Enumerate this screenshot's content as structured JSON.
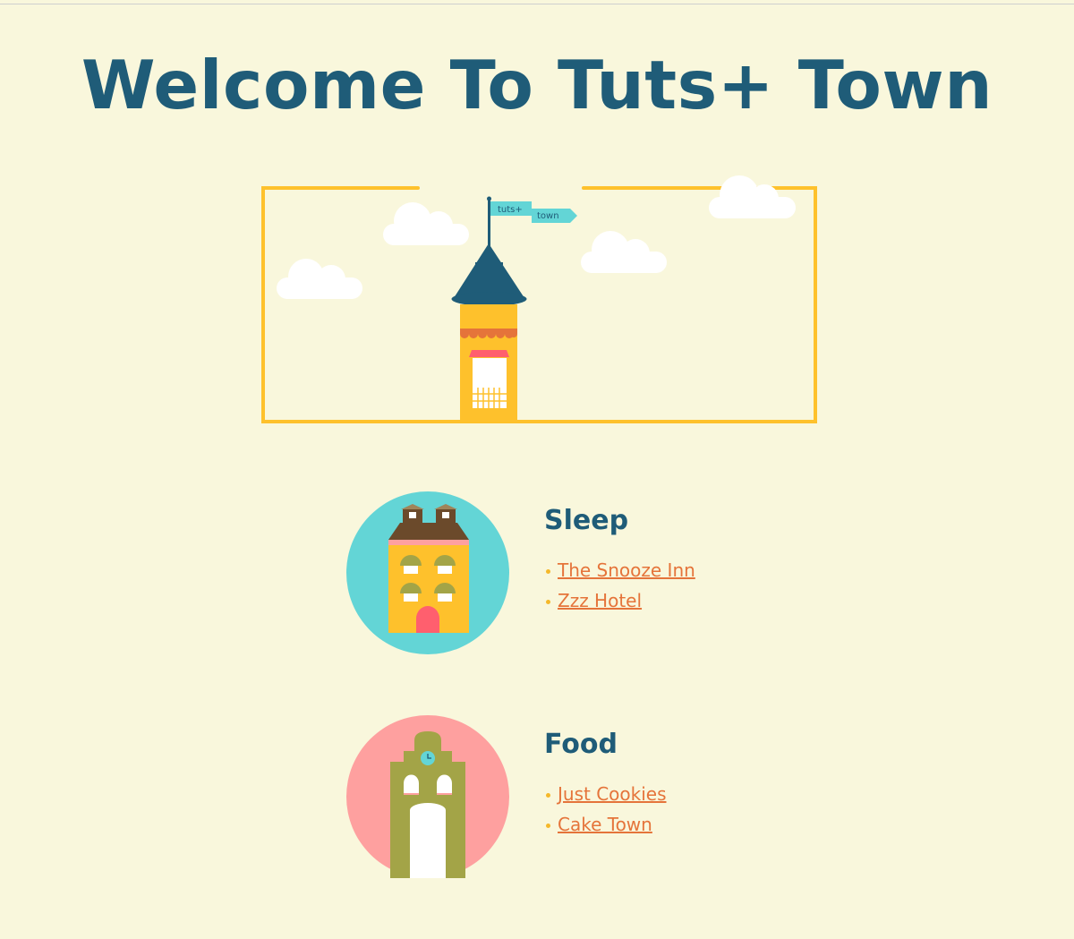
{
  "page": {
    "title": "Welcome To Tuts+ Town"
  },
  "hero": {
    "flag_text_1": "tuts+",
    "flag_text_2": "town"
  },
  "sections": [
    {
      "heading": "Sleep",
      "icon": "hotel-building-icon",
      "badge_color": "#63d5d6",
      "links": [
        "The Snooze Inn",
        "Zzz Hotel"
      ]
    },
    {
      "heading": "Food",
      "icon": "bakery-building-icon",
      "badge_color": "#fea09f",
      "links": [
        "Just Cookies",
        "Cake Town"
      ]
    }
  ],
  "colors": {
    "title": "#1f5c78",
    "background": "#f9f7dc",
    "link": "#e5743a",
    "frame": "#fec12c"
  }
}
